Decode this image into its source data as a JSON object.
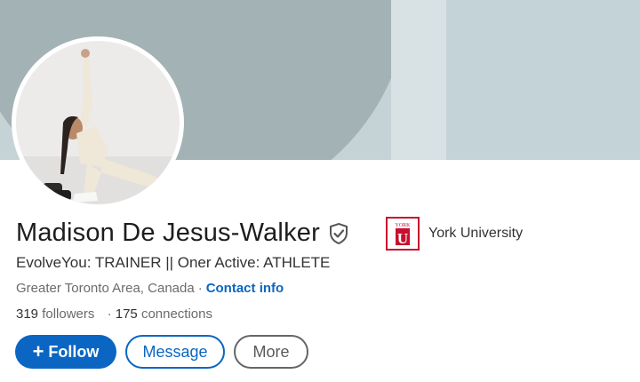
{
  "profile": {
    "name": "Madison De Jesus-Walker",
    "headline": "EvolveYou: TRAINER || Oner Active: ATHLETE",
    "location": "Greater Toronto Area, Canada",
    "separator": "·",
    "contact_label": "Contact info",
    "followers_count": "319",
    "followers_label": "followers",
    "connections_separator": "·",
    "connections_count": "175",
    "connections_label": "connections"
  },
  "actions": {
    "follow_icon": "+",
    "follow_label": "Follow",
    "message_label": "Message",
    "more_label": "More"
  },
  "education": {
    "school_name": "York University",
    "logo_text": "YORK",
    "logo_letter": "U"
  },
  "icons": {
    "verified": "verified-shield-icon",
    "plus": "plus-icon",
    "school_logo": "york-university-logo"
  },
  "colors": {
    "accent": "#0a66c2",
    "text_primary": "#1d1d1d",
    "text_secondary": "#6b6b6b",
    "cover_dark": "#a3b2b5",
    "cover_light": "#c4d3d8",
    "york_red": "#c8102e"
  }
}
